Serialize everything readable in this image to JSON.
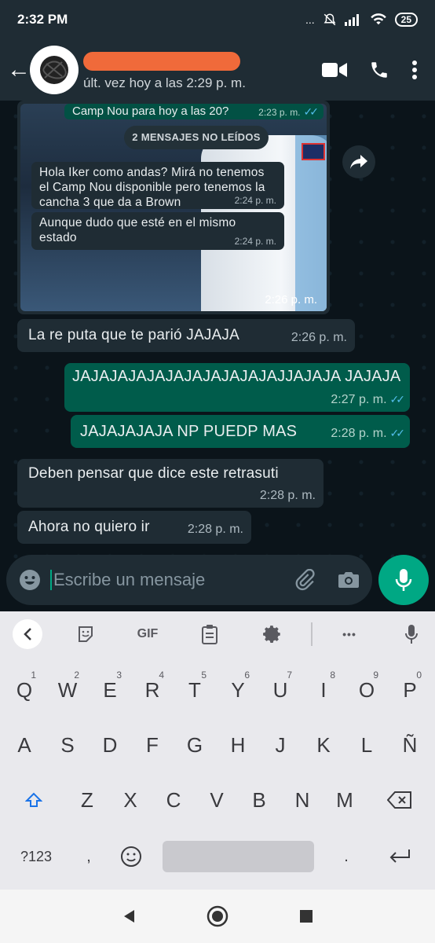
{
  "status": {
    "time": "2:32 PM",
    "battery": "25",
    "dots": "..."
  },
  "header": {
    "last_seen": "últ. vez hoy a las 2:29 p. m."
  },
  "chat": {
    "quoted": {
      "text": "Camp Nou para hoy a las 20?",
      "time": "2:23 p. m."
    },
    "unread_label": "2 MENSAJES NO LEÍDOS",
    "image_messages": [
      {
        "text": "Hola Iker como andas? Mirá no tenemos el Camp Nou disponible pero tenemos la cancha 3 que da a Brown",
        "time": "2:24 p. m."
      },
      {
        "text": "Aunque dudo que esté en el mismo estado",
        "time": "2:24 p. m."
      }
    ],
    "image_time": "2:26 p. m.",
    "messages": [
      {
        "dir": "in",
        "text": "La re puta que te parió JAJAJA",
        "time": "2:26 p. m."
      },
      {
        "dir": "out",
        "text": "JAJAJAJAJAJAJAJAJAJAJAJJAJAJA JAJAJA",
        "time": "2:27 p. m."
      },
      {
        "dir": "out",
        "text": "JAJAJAJAJA NP PUEDP MAS",
        "time": "2:28 p. m."
      },
      {
        "dir": "in",
        "text": "Deben pensar que dice este retrasuti",
        "time": "2:28 p. m."
      },
      {
        "dir": "in",
        "text": "Ahora no quiero ir",
        "time": "2:28 p. m."
      }
    ]
  },
  "input": {
    "placeholder": "Escribe un mensaje"
  },
  "keyboard": {
    "toolbar": {
      "gif": "GIF",
      "more": "•••"
    },
    "row1": [
      "Q",
      "W",
      "E",
      "R",
      "T",
      "Y",
      "U",
      "I",
      "O",
      "P"
    ],
    "row1_nums": [
      "1",
      "2",
      "3",
      "4",
      "5",
      "6",
      "7",
      "8",
      "9",
      "0"
    ],
    "row2": [
      "A",
      "S",
      "D",
      "F",
      "G",
      "H",
      "J",
      "K",
      "L",
      "Ñ"
    ],
    "row3": [
      "Z",
      "X",
      "C",
      "V",
      "B",
      "N",
      "M"
    ],
    "row4": {
      "symbols": "?123",
      "comma": ",",
      "period": "."
    }
  },
  "colors": {
    "outgoing": "#005c4b",
    "incoming": "#1f2c34",
    "accent": "#00a884",
    "read_tick": "#53bdeb"
  }
}
